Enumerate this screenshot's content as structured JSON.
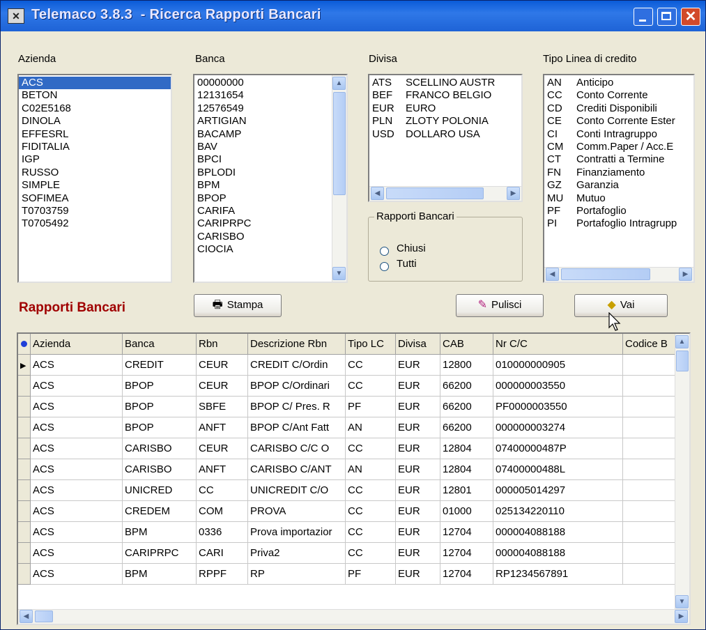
{
  "window": {
    "title": "Telemaco 3.8.3  - Ricerca Rapporti Bancari",
    "icon": "app-icon"
  },
  "azienda": {
    "label": "Azienda",
    "selected": "ACS",
    "items": [
      "ACS",
      "BETON",
      "C02E5168",
      "DINOLA",
      "EFFESRL",
      "FIDITALIA",
      "IGP",
      "RUSSO",
      "SIMPLE",
      "SOFIMEA",
      "T0703759",
      "T0705492"
    ]
  },
  "banca": {
    "label": "Banca",
    "items": [
      "00000000",
      "12131654",
      "12576549",
      "ARTIGIAN",
      "BACAMP",
      "BAV",
      "BPCI",
      "BPLODI",
      "BPM",
      "BPOP",
      "CARIFA",
      "CARIPRPC",
      "CARISBO",
      "CIOCIA"
    ]
  },
  "divisa": {
    "label": "Divisa",
    "items": [
      {
        "code": "ATS",
        "name": "SCELLINO AUSTR"
      },
      {
        "code": "BEF",
        "name": "FRANCO BELGIO"
      },
      {
        "code": "EUR",
        "name": "EURO"
      },
      {
        "code": "PLN",
        "name": "ZLOTY POLONIA"
      },
      {
        "code": "USD",
        "name": "DOLLARO USA"
      }
    ]
  },
  "tipo_linea": {
    "label": "Tipo Linea di credito",
    "items": [
      {
        "code": "AN",
        "name": "Anticipo"
      },
      {
        "code": "CC",
        "name": "Conto Corrente"
      },
      {
        "code": "CD",
        "name": "Crediti Disponibili"
      },
      {
        "code": "CE",
        "name": "Conto Corrente Ester"
      },
      {
        "code": "CI",
        "name": "Conti Intragruppo"
      },
      {
        "code": "CM",
        "name": "Comm.Paper / Acc.E"
      },
      {
        "code": "CT",
        "name": "Contratti a Termine"
      },
      {
        "code": "FN",
        "name": "Finanziamento"
      },
      {
        "code": "GZ",
        "name": "Garanzia"
      },
      {
        "code": "MU",
        "name": "Mutuo"
      },
      {
        "code": "PF",
        "name": "Portafoglio"
      },
      {
        "code": "PI",
        "name": "Portafoglio Intragrupp"
      }
    ]
  },
  "rapporti_group": {
    "title": "Rapporti Bancari",
    "options": [
      "Chiusi",
      "Tutti"
    ]
  },
  "section_title": "Rapporti Bancari",
  "buttons": {
    "stampa": "Stampa",
    "pulisci": "Pulisci",
    "vai": "Vai"
  },
  "grid": {
    "columns": [
      "Azienda",
      "Banca",
      "Rbn",
      "Descrizione Rbn",
      "Tipo LC",
      "Divisa",
      "CAB",
      "Nr C/C",
      "Codice B"
    ],
    "rows": [
      [
        "ACS",
        "CREDIT",
        "CEUR",
        "CREDIT C/Ordin",
        "CC",
        "EUR",
        "12800",
        "010000000905"
      ],
      [
        "ACS",
        "BPOP",
        "CEUR",
        "BPOP C/Ordinari",
        "CC",
        "EUR",
        "66200",
        "000000003550"
      ],
      [
        "ACS",
        "BPOP",
        "SBFE",
        "BPOP C/ Pres. R",
        "PF",
        "EUR",
        "66200",
        "PF0000003550"
      ],
      [
        "ACS",
        "BPOP",
        "ANFT",
        "BPOP C/Ant Fatt",
        "AN",
        "EUR",
        "66200",
        "000000003274"
      ],
      [
        "ACS",
        "CARISBO",
        "CEUR",
        "CARISBO C/C O",
        "CC",
        "EUR",
        "12804",
        "07400000487P"
      ],
      [
        "ACS",
        "CARISBO",
        "ANFT",
        "CARISBO C/ANT",
        "AN",
        "EUR",
        "12804",
        "07400000488L"
      ],
      [
        "ACS",
        "UNICRED",
        "CC",
        "UNICREDIT C/O",
        "CC",
        "EUR",
        "12801",
        "000005014297"
      ],
      [
        "ACS",
        "CREDEM",
        "COM",
        "PROVA",
        "CC",
        "EUR",
        "01000",
        "025134220110"
      ],
      [
        "ACS",
        "BPM",
        "0336",
        "Prova importazior",
        "CC",
        "EUR",
        "12704",
        "000004088188"
      ],
      [
        "ACS",
        "CARIPRPC",
        "CARI",
        "Priva2",
        "CC",
        "EUR",
        "12704",
        "000004088188"
      ],
      [
        "ACS",
        "BPM",
        "RPPF",
        "RP",
        "PF",
        "EUR",
        "12704",
        "RP1234567891"
      ]
    ]
  },
  "colors": {
    "title_bar": "#1e63d6",
    "selection": "#316ac5",
    "section_title": "#a00000",
    "window_bg": "#ece9d8"
  }
}
